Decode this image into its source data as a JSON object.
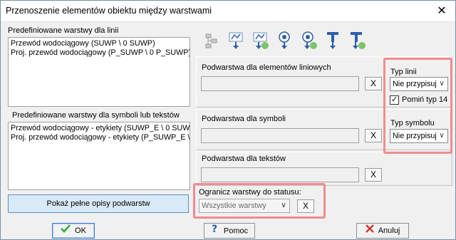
{
  "window": {
    "title": "Przenoszenie elementów obiektu między warstwami",
    "close_icon": "close-icon"
  },
  "left": {
    "lines_label": "Predefiniowane warstwy dla linii",
    "lines_items": [
      "Przewód wodociągowy (SUWP \\ 0 SUWP)",
      "Proj. przewód wodociągowy (P_SUWP \\ 0 P_SUWP)"
    ],
    "symbols_label": "Predefiniowane warstwy dla symboli lub tekstów",
    "symbols_items": [
      "Przewód wodociągowy - etykiety (SUWP_E \\ 0 SUWP",
      "Proj. przewód wodociągowy - etykiety (P_SUWP_E \\ 0"
    ],
    "show_full_button": "Pokaż pełne opisy podwarstw"
  },
  "toolbar": {
    "icons": [
      "layers-tree-icon",
      "move-line-icon",
      "move-line-check-icon",
      "move-symbol-icon",
      "move-symbol-check-icon",
      "move-text-icon",
      "move-text-check-icon"
    ]
  },
  "right": {
    "line_sublayer_label": "Podwarstwa dla elementów liniowych",
    "symbol_sublayer_label": "Podwarstwa dla symboli",
    "text_sublayer_label": "Podwarstwa dla tekstów",
    "clear_label": "X",
    "line_type_label": "Typ linii",
    "line_type_value": "Nie przypisuj",
    "skip_type_label": "Pomiń typ 14",
    "skip_type_checked": "✓",
    "symbol_type_label": "Typ symbolu",
    "symbol_type_value": "Nie przypisuj",
    "status_label": "Ogranicz warstwy do statusu:",
    "status_value": "Wszystkie warstwy"
  },
  "buttons": {
    "ok": "OK",
    "help": "Pomoc",
    "cancel": "Anuluj"
  },
  "colors": {
    "highlight": "#f08c8c",
    "accent": "#3c7fd4"
  }
}
